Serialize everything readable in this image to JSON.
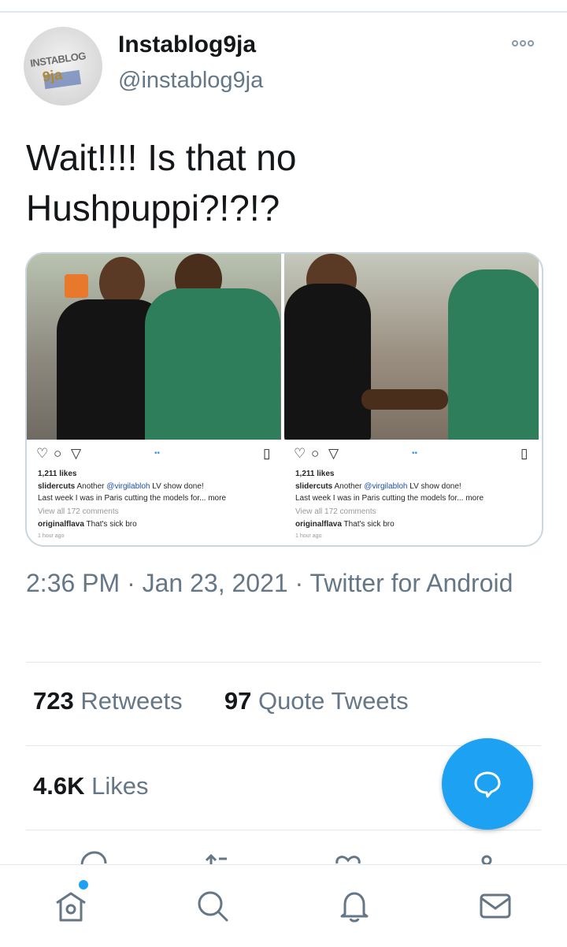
{
  "tweet": {
    "author": {
      "display_name": "Instablog9ja",
      "handle": "@instablog9ja",
      "avatar_text_1": "INSTABLOG",
      "avatar_text_2": "9ja"
    },
    "text": "Wait!!!! Is that no\nHushpuppi?!?!?",
    "timestamp": "2:36 PM · Jan 23, 2021 · Twitter for Android",
    "stats": {
      "retweets_count": "723",
      "retweets_label": "Retweets",
      "quotes_count": "97",
      "quotes_label": "Quote Tweets",
      "likes_count": "4.6K",
      "likes_label": "Likes"
    }
  },
  "media": {
    "panels": [
      {
        "likes": "1,211 likes",
        "caption_user": "slidercuts",
        "caption_pre": "Another ",
        "mention": "@virgilabloh",
        "caption_post": " LV show done!",
        "caption_line2": "Last week I was in Paris cutting the models for...",
        "more": "more",
        "view_comments": "View all 172 comments",
        "comment_user": "originalflava",
        "comment_text": "That's sick bro",
        "time_ago": "1 hour ago"
      },
      {
        "likes": "1,211 likes",
        "caption_user": "slidercuts",
        "caption_pre": "Another ",
        "mention": "@virgilabloh",
        "caption_post": " LV show done!",
        "caption_line2": "Last week I was in Paris cutting the models for...",
        "more": "more",
        "view_comments": "View all 172 comments",
        "comment_user": "originalflava",
        "comment_text": "That's sick bro",
        "time_ago": "1 hour ago"
      }
    ]
  },
  "icons": {
    "more": "more-options-icon",
    "compose": "compose-reply-icon",
    "nav": [
      "home-icon",
      "search-icon",
      "notifications-icon",
      "messages-icon"
    ]
  },
  "colors": {
    "accent": "#1da1f2",
    "text": "#14171a",
    "secondary": "#657786",
    "divider": "#e1e8ed"
  }
}
